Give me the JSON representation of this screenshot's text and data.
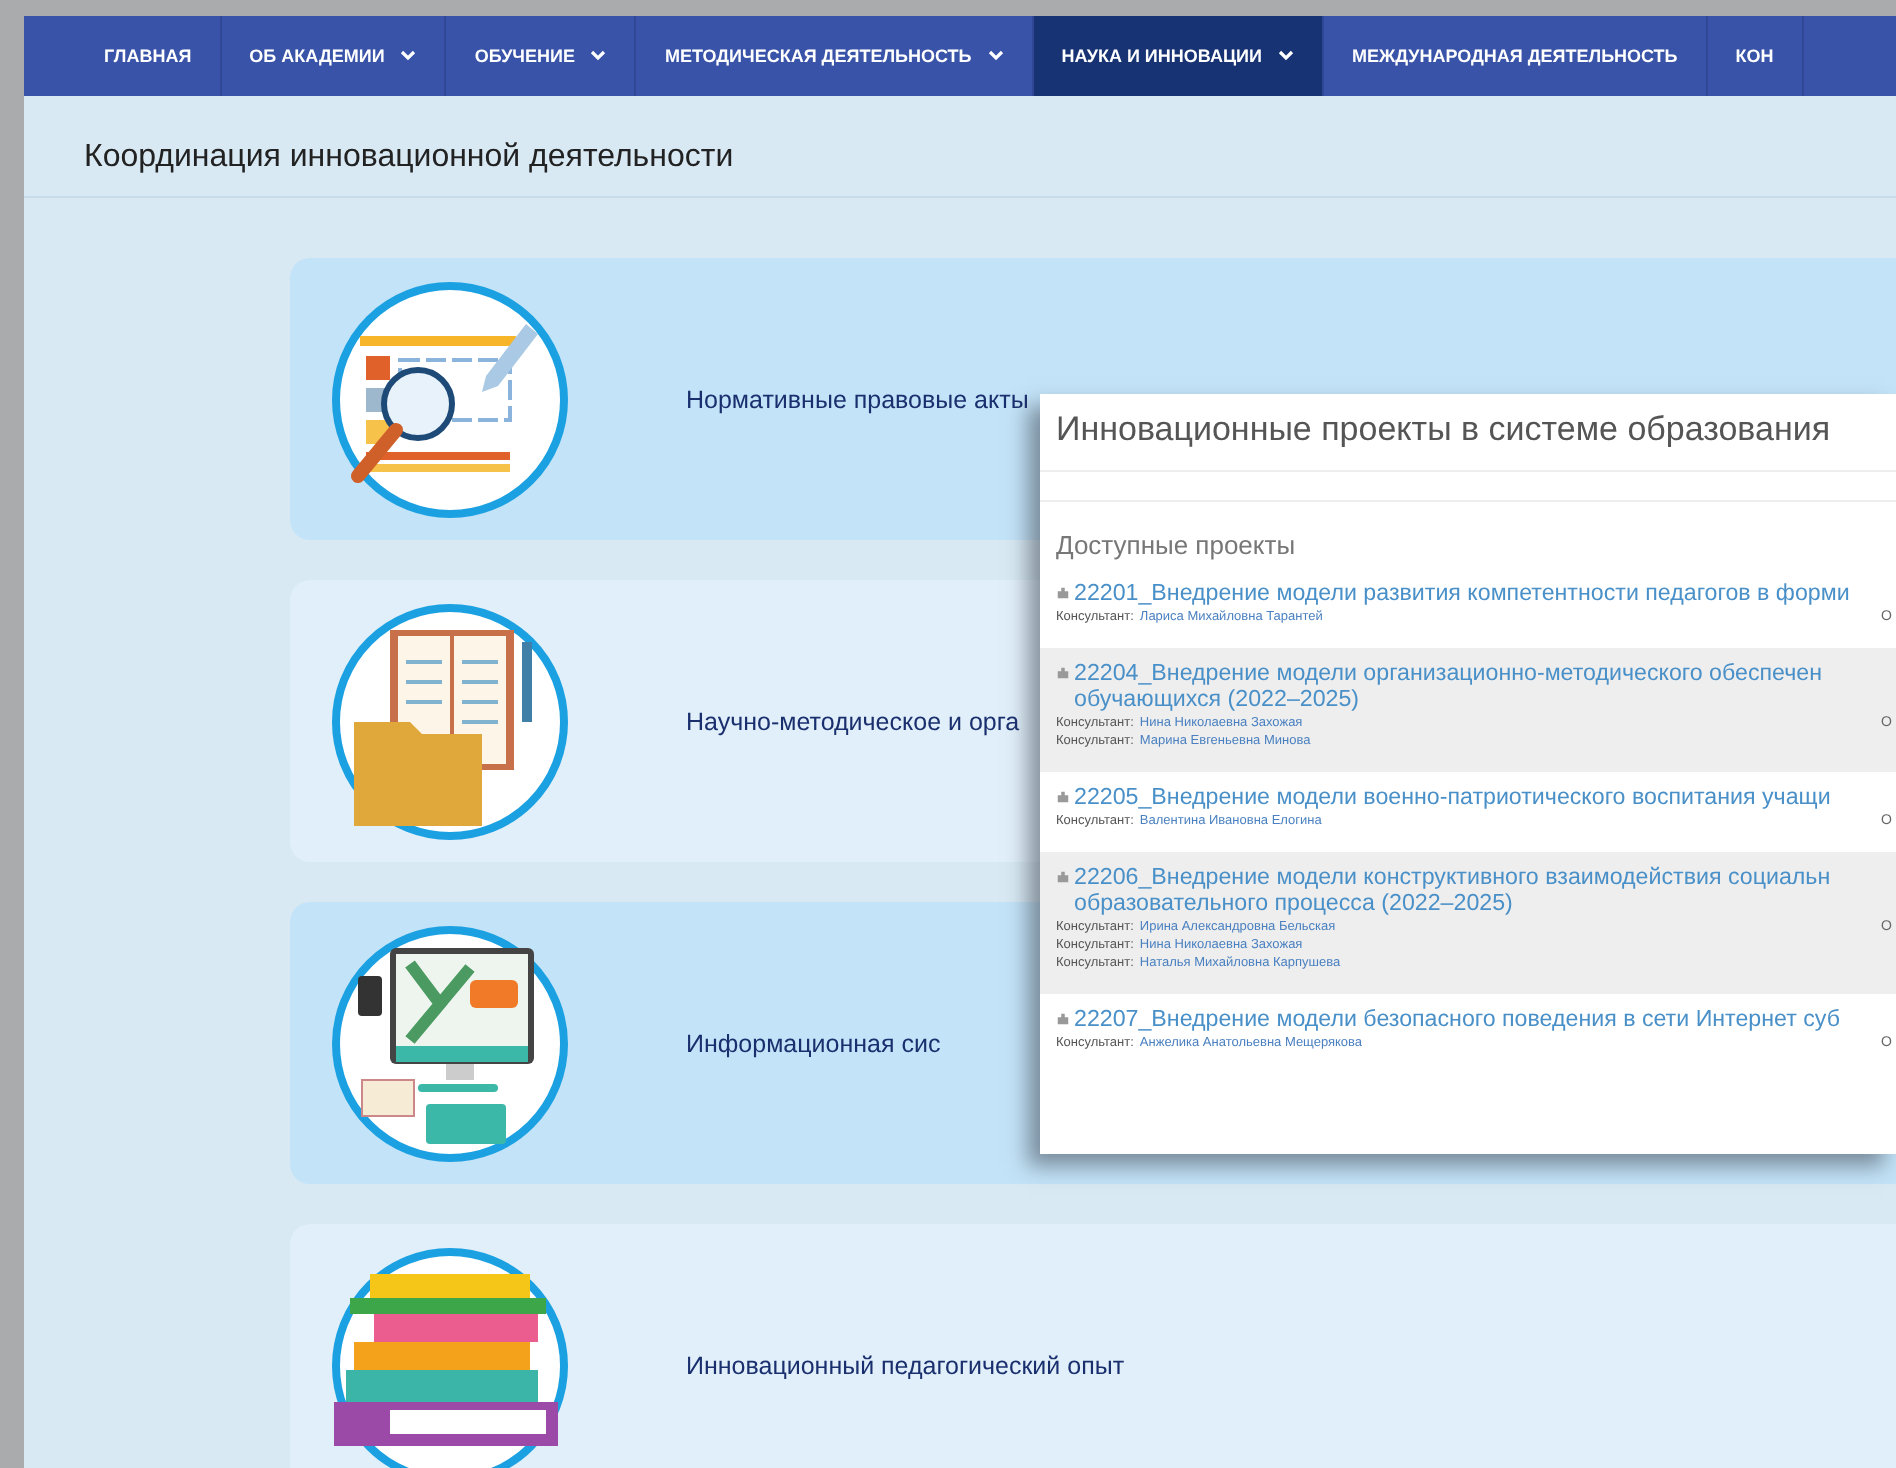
{
  "nav": {
    "items": [
      {
        "label": "ГЛАВНАЯ",
        "has_menu": false,
        "selected": false
      },
      {
        "label": "ОБ АКАДЕМИИ",
        "has_menu": true,
        "selected": false
      },
      {
        "label": "ОБУЧЕНИЕ",
        "has_menu": true,
        "selected": false
      },
      {
        "label": "МЕТОДИЧЕСКАЯ ДЕЯТЕЛЬНОСТЬ",
        "has_menu": true,
        "selected": false
      },
      {
        "label": "НАУКА И ИННОВАЦИИ",
        "has_menu": true,
        "selected": true
      },
      {
        "label": "МЕЖДУНАРОДНАЯ ДЕЯТЕЛЬНОСТЬ",
        "has_menu": false,
        "selected": false
      },
      {
        "label": "КОН",
        "has_menu": false,
        "selected": false
      }
    ]
  },
  "page_title": "Координация инновационной деятельности",
  "cards": [
    {
      "kind": "document-search",
      "label": "Нормативные правовые акты"
    },
    {
      "kind": "folder-notebook",
      "label": "Научно-методическое и орга"
    },
    {
      "kind": "computer",
      "label": "Информационная сис"
    },
    {
      "kind": "books",
      "label": "Инновационный педагогический опыт"
    }
  ],
  "popup": {
    "title": "Инновационные проекты в системе образования",
    "section": "Доступные проекты",
    "projects": [
      {
        "title_lines": [
          "22201_Внедрение модели развития компетентности педагогов в форми"
        ],
        "consultants": [
          {
            "label": "Консультант:",
            "name": "Лариса Михайловна Тарантей"
          }
        ],
        "action": "О"
      },
      {
        "title_lines": [
          "22204_Внедрение модели организационно-методического обеспечен",
          "обучающихся (2022–2025)"
        ],
        "consultants": [
          {
            "label": "Консультант:",
            "name": "Нина Николаевна Захожая"
          },
          {
            "label": "Консультант:",
            "name": "Марина Евгеньевна Минова"
          }
        ],
        "action": "О"
      },
      {
        "title_lines": [
          "22205_Внедрение модели военно-патриотического воспитания учащи"
        ],
        "consultants": [
          {
            "label": "Консультант:",
            "name": "Валентина Ивановна Елогина"
          }
        ],
        "action": "О"
      },
      {
        "title_lines": [
          "22206_Внедрение модели конструктивного взаимодействия социальн",
          "образовательного процесса (2022–2025)"
        ],
        "consultants": [
          {
            "label": "Консультант:",
            "name": "Ирина Александровна Бельская"
          },
          {
            "label": "Консультант:",
            "name": "Нина Николаевна Захожая"
          },
          {
            "label": "Консультант:",
            "name": "Наталья Михайловна Карпушева"
          }
        ],
        "action": "О"
      },
      {
        "title_lines": [
          "22207_Внедрение модели безопасного поведения в сети Интернет суб"
        ],
        "consultants": [
          {
            "label": "Консультант:",
            "name": "Анжелика Анатольевна Мещерякова"
          }
        ],
        "action": "О"
      }
    ]
  }
}
